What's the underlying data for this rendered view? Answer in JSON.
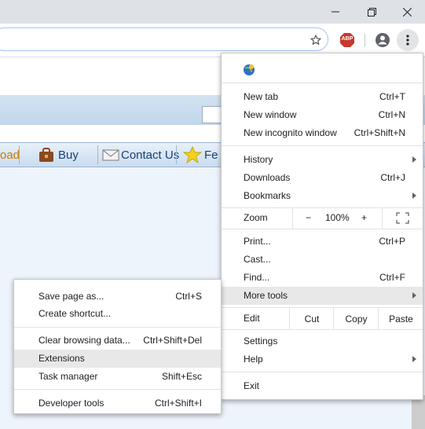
{
  "window": {
    "minimize_icon": "minimize-icon",
    "restore_icon": "restore-icon",
    "close_icon": "close-icon"
  },
  "toolbar": {
    "bookmark_icon": "star-icon",
    "extension_label": "ABP",
    "profile_icon": "account-icon",
    "menu_icon": "three-dots-icon"
  },
  "page": {
    "nav": [
      {
        "label": "oad"
      },
      {
        "label": "Buy"
      },
      {
        "label": "Contact Us"
      },
      {
        "label": "Fe"
      }
    ]
  },
  "menu": {
    "header_icon": "extension-globe-icon",
    "new_tab": {
      "label": "New tab",
      "shortcut": "Ctrl+T"
    },
    "new_window": {
      "label": "New window",
      "shortcut": "Ctrl+N"
    },
    "new_incognito": {
      "label": "New incognito window",
      "shortcut": "Ctrl+Shift+N"
    },
    "history": {
      "label": "History"
    },
    "downloads": {
      "label": "Downloads",
      "shortcut": "Ctrl+J"
    },
    "bookmarks": {
      "label": "Bookmarks"
    },
    "zoom": {
      "label": "Zoom",
      "minus": "−",
      "value": "100%",
      "plus": "+"
    },
    "print": {
      "label": "Print...",
      "shortcut": "Ctrl+P"
    },
    "cast": {
      "label": "Cast..."
    },
    "find": {
      "label": "Find...",
      "shortcut": "Ctrl+F"
    },
    "more_tools": {
      "label": "More tools"
    },
    "edit": {
      "label": "Edit",
      "cut": "Cut",
      "copy": "Copy",
      "paste": "Paste"
    },
    "settings": {
      "label": "Settings"
    },
    "help": {
      "label": "Help"
    },
    "exit": {
      "label": "Exit"
    }
  },
  "submenu": {
    "save_page": {
      "label": "Save page as...",
      "shortcut": "Ctrl+S"
    },
    "create_shortcut": {
      "label": "Create shortcut..."
    },
    "clear_browsing": {
      "label": "Clear browsing data...",
      "shortcut": "Ctrl+Shift+Del"
    },
    "extensions": {
      "label": "Extensions"
    },
    "task_manager": {
      "label": "Task manager",
      "shortcut": "Shift+Esc"
    },
    "developer_tools": {
      "label": "Developer tools",
      "shortcut": "Ctrl+Shift+I"
    }
  }
}
